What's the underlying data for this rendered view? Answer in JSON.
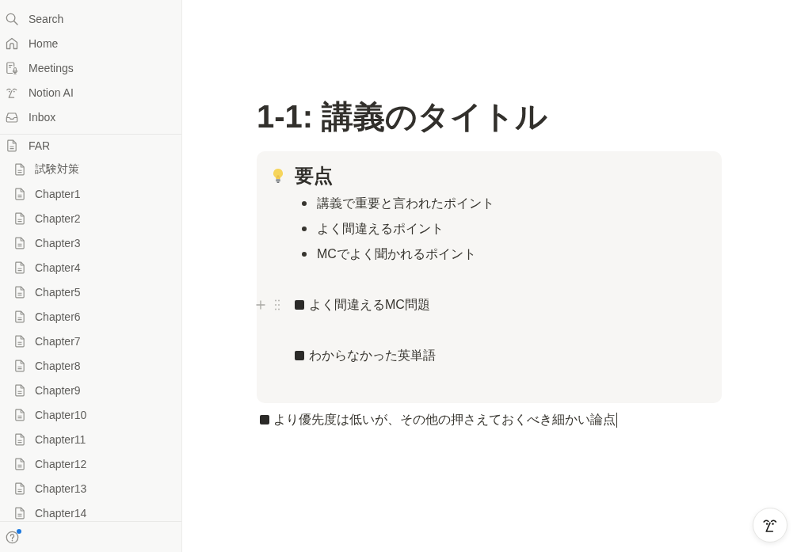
{
  "sidebar": {
    "nav_items": [
      {
        "kind": "search",
        "label": "Search",
        "selected": false
      },
      {
        "kind": "home",
        "label": "Home",
        "selected": false
      },
      {
        "kind": "meetings",
        "label": "Meetings",
        "selected": false
      },
      {
        "kind": "ai",
        "label": "Notion AI",
        "selected": false
      },
      {
        "kind": "inbox",
        "label": "Inbox",
        "selected": false
      }
    ],
    "pages": [
      {
        "label": "FAR",
        "selected": false,
        "children": [
          {
            "label": "試験対策",
            "selected": false
          },
          {
            "label": "Chapter1",
            "selected": false
          },
          {
            "label": "Chapter2",
            "selected": false
          },
          {
            "label": "Chapter3",
            "selected": false
          },
          {
            "label": "Chapter4",
            "selected": false
          },
          {
            "label": "Chapter5",
            "selected": false
          },
          {
            "label": "Chapter6",
            "selected": false
          },
          {
            "label": "Chapter7",
            "selected": false
          },
          {
            "label": "Chapter8",
            "selected": false
          },
          {
            "label": "Chapter9",
            "selected": false
          },
          {
            "label": "Chapter10",
            "selected": false
          },
          {
            "label": "Chapter11",
            "selected": false
          },
          {
            "label": "Chapter12",
            "selected": false
          },
          {
            "label": "Chapter13",
            "selected": false
          },
          {
            "label": "Chapter14",
            "selected": false
          }
        ]
      }
    ],
    "help": {
      "notification": true
    }
  },
  "page": {
    "title": "1-1: 講義のタイトル",
    "callout": {
      "heading": "要点",
      "bullets": [
        "講義で重要と言われたポイント",
        "よく間違えるポイント",
        "MCでよく聞かれるポイント"
      ],
      "blocks": [
        {
          "text": "よく間違えるMC問題",
          "hovered": true
        },
        {
          "text": "わからなかった英単語",
          "hovered": false
        }
      ]
    },
    "blocks": [
      {
        "text": "より優先度は低いが、その他の押さえておくべき細かい論点",
        "caret": true
      }
    ]
  }
}
